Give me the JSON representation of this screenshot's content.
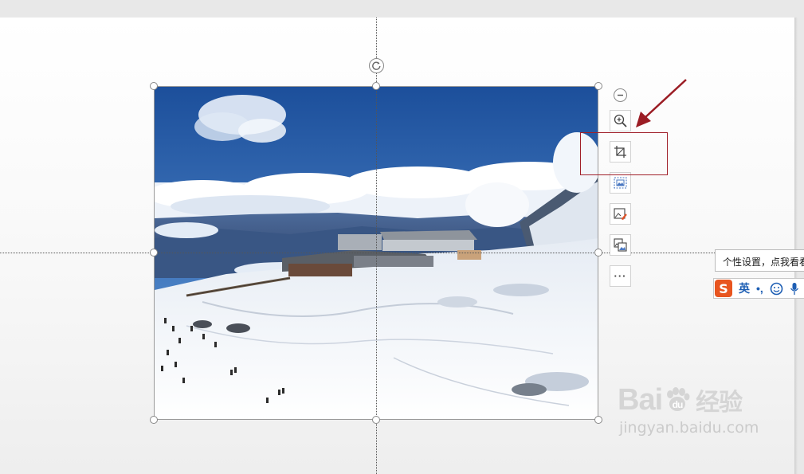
{
  "toolbar": {
    "items": [
      "collapse",
      "zoom-in",
      "crop",
      "picture-effects",
      "modify-picture",
      "change-picture",
      "more"
    ],
    "more_label": "···"
  },
  "tooltip": {
    "text": "个性设置，点我看看"
  },
  "ime": {
    "logo": "S",
    "lang": "英",
    "punct": "•,"
  },
  "watermark": {
    "brand": "Bai",
    "brand_suffix": "du",
    "cn": "经验",
    "url": "jingyan.baidu.com"
  },
  "colors": {
    "annotation": "#a0202a",
    "ime_accent": "#1e5fb4",
    "ime_logo": "#e8551f"
  },
  "photo": {
    "subject": "snowy mountain station above clouds"
  }
}
